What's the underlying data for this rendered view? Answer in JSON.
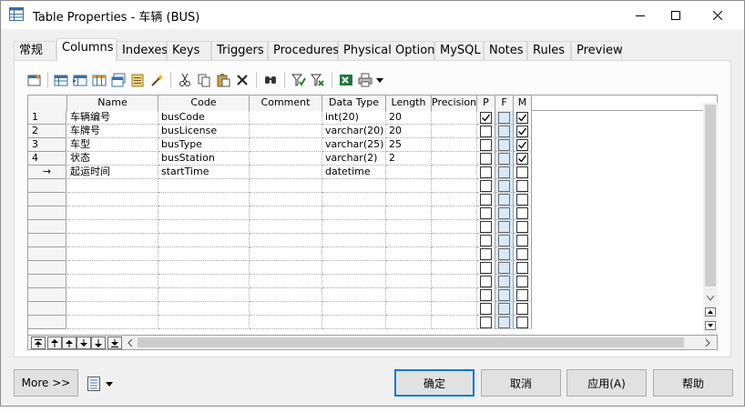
{
  "window": {
    "title": "Table Properties - 车辆 (BUS)"
  },
  "tabs": [
    {
      "label": "常规"
    },
    {
      "label": "Columns"
    },
    {
      "label": "Indexes"
    },
    {
      "label": "Keys"
    },
    {
      "label": "Triggers"
    },
    {
      "label": "Procedures"
    },
    {
      "label": "Physical Options"
    },
    {
      "label": "MySQL"
    },
    {
      "label": "Notes"
    },
    {
      "label": "Rules"
    },
    {
      "label": "Preview"
    }
  ],
  "active_tab": "Columns",
  "grid": {
    "headers": [
      "Name",
      "Code",
      "Comment",
      "Data Type",
      "Length",
      "Precision",
      "P",
      "F",
      "M"
    ],
    "rows": [
      {
        "rownum": "1",
        "name": "车辆编号",
        "code": "busCode",
        "comment": "",
        "datatype": "int(20)",
        "length": "20",
        "precision": "",
        "p": true,
        "f": false,
        "m": true
      },
      {
        "rownum": "2",
        "name": "车牌号",
        "code": "busLicense",
        "comment": "",
        "datatype": "varchar(20)",
        "length": "20",
        "precision": "",
        "p": false,
        "f": false,
        "m": true
      },
      {
        "rownum": "3",
        "name": "车型",
        "code": "busType",
        "comment": "",
        "datatype": "varchar(25)",
        "length": "25",
        "precision": "",
        "p": false,
        "f": false,
        "m": true
      },
      {
        "rownum": "4",
        "name": "状态",
        "code": "busStation",
        "comment": "",
        "datatype": "varchar(2)",
        "length": "2",
        "precision": "",
        "p": false,
        "f": false,
        "m": true
      },
      {
        "rownum": "→",
        "name": "起运时间",
        "code": "startTime",
        "comment": "",
        "datatype": "datetime",
        "length": "",
        "precision": "",
        "p": false,
        "f": false,
        "m": false
      }
    ],
    "empty_rows": 11
  },
  "buttons": {
    "more": "More >>",
    "ok": "确定",
    "cancel": "取消",
    "apply": "应用(A)",
    "help": "帮助"
  }
}
